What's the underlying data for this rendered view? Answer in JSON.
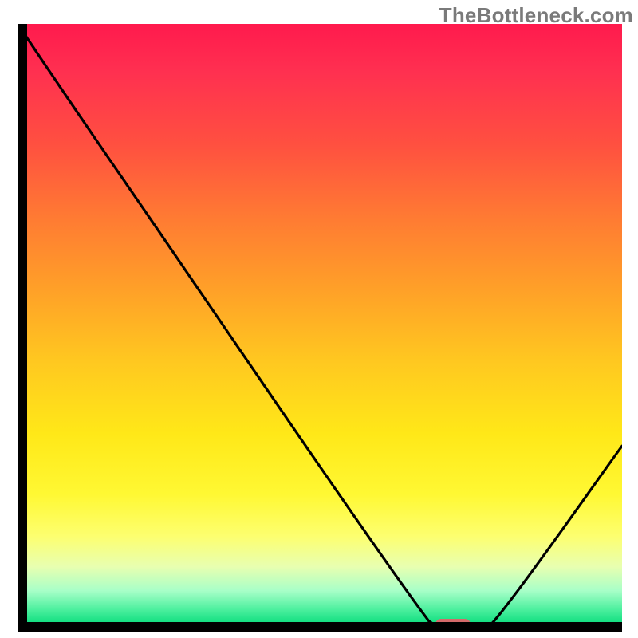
{
  "watermark": "TheBottleneck.com",
  "chart_data": {
    "type": "line",
    "title": "",
    "xlabel": "",
    "ylabel": "",
    "xlim": [
      0,
      100
    ],
    "ylim": [
      0,
      100
    ],
    "x": [
      0,
      19,
      68,
      73,
      78,
      100
    ],
    "values": [
      100,
      72,
      1,
      0,
      0,
      30
    ],
    "marker": {
      "x": 72,
      "y": 0
    },
    "background": "gradient-red-to-green",
    "colors": {
      "top": "#ff1a4d",
      "mid": "#ffd020",
      "bottom": "#00da78",
      "curve": "#000000",
      "marker": "#d46a6a",
      "axes": "#000000"
    }
  }
}
